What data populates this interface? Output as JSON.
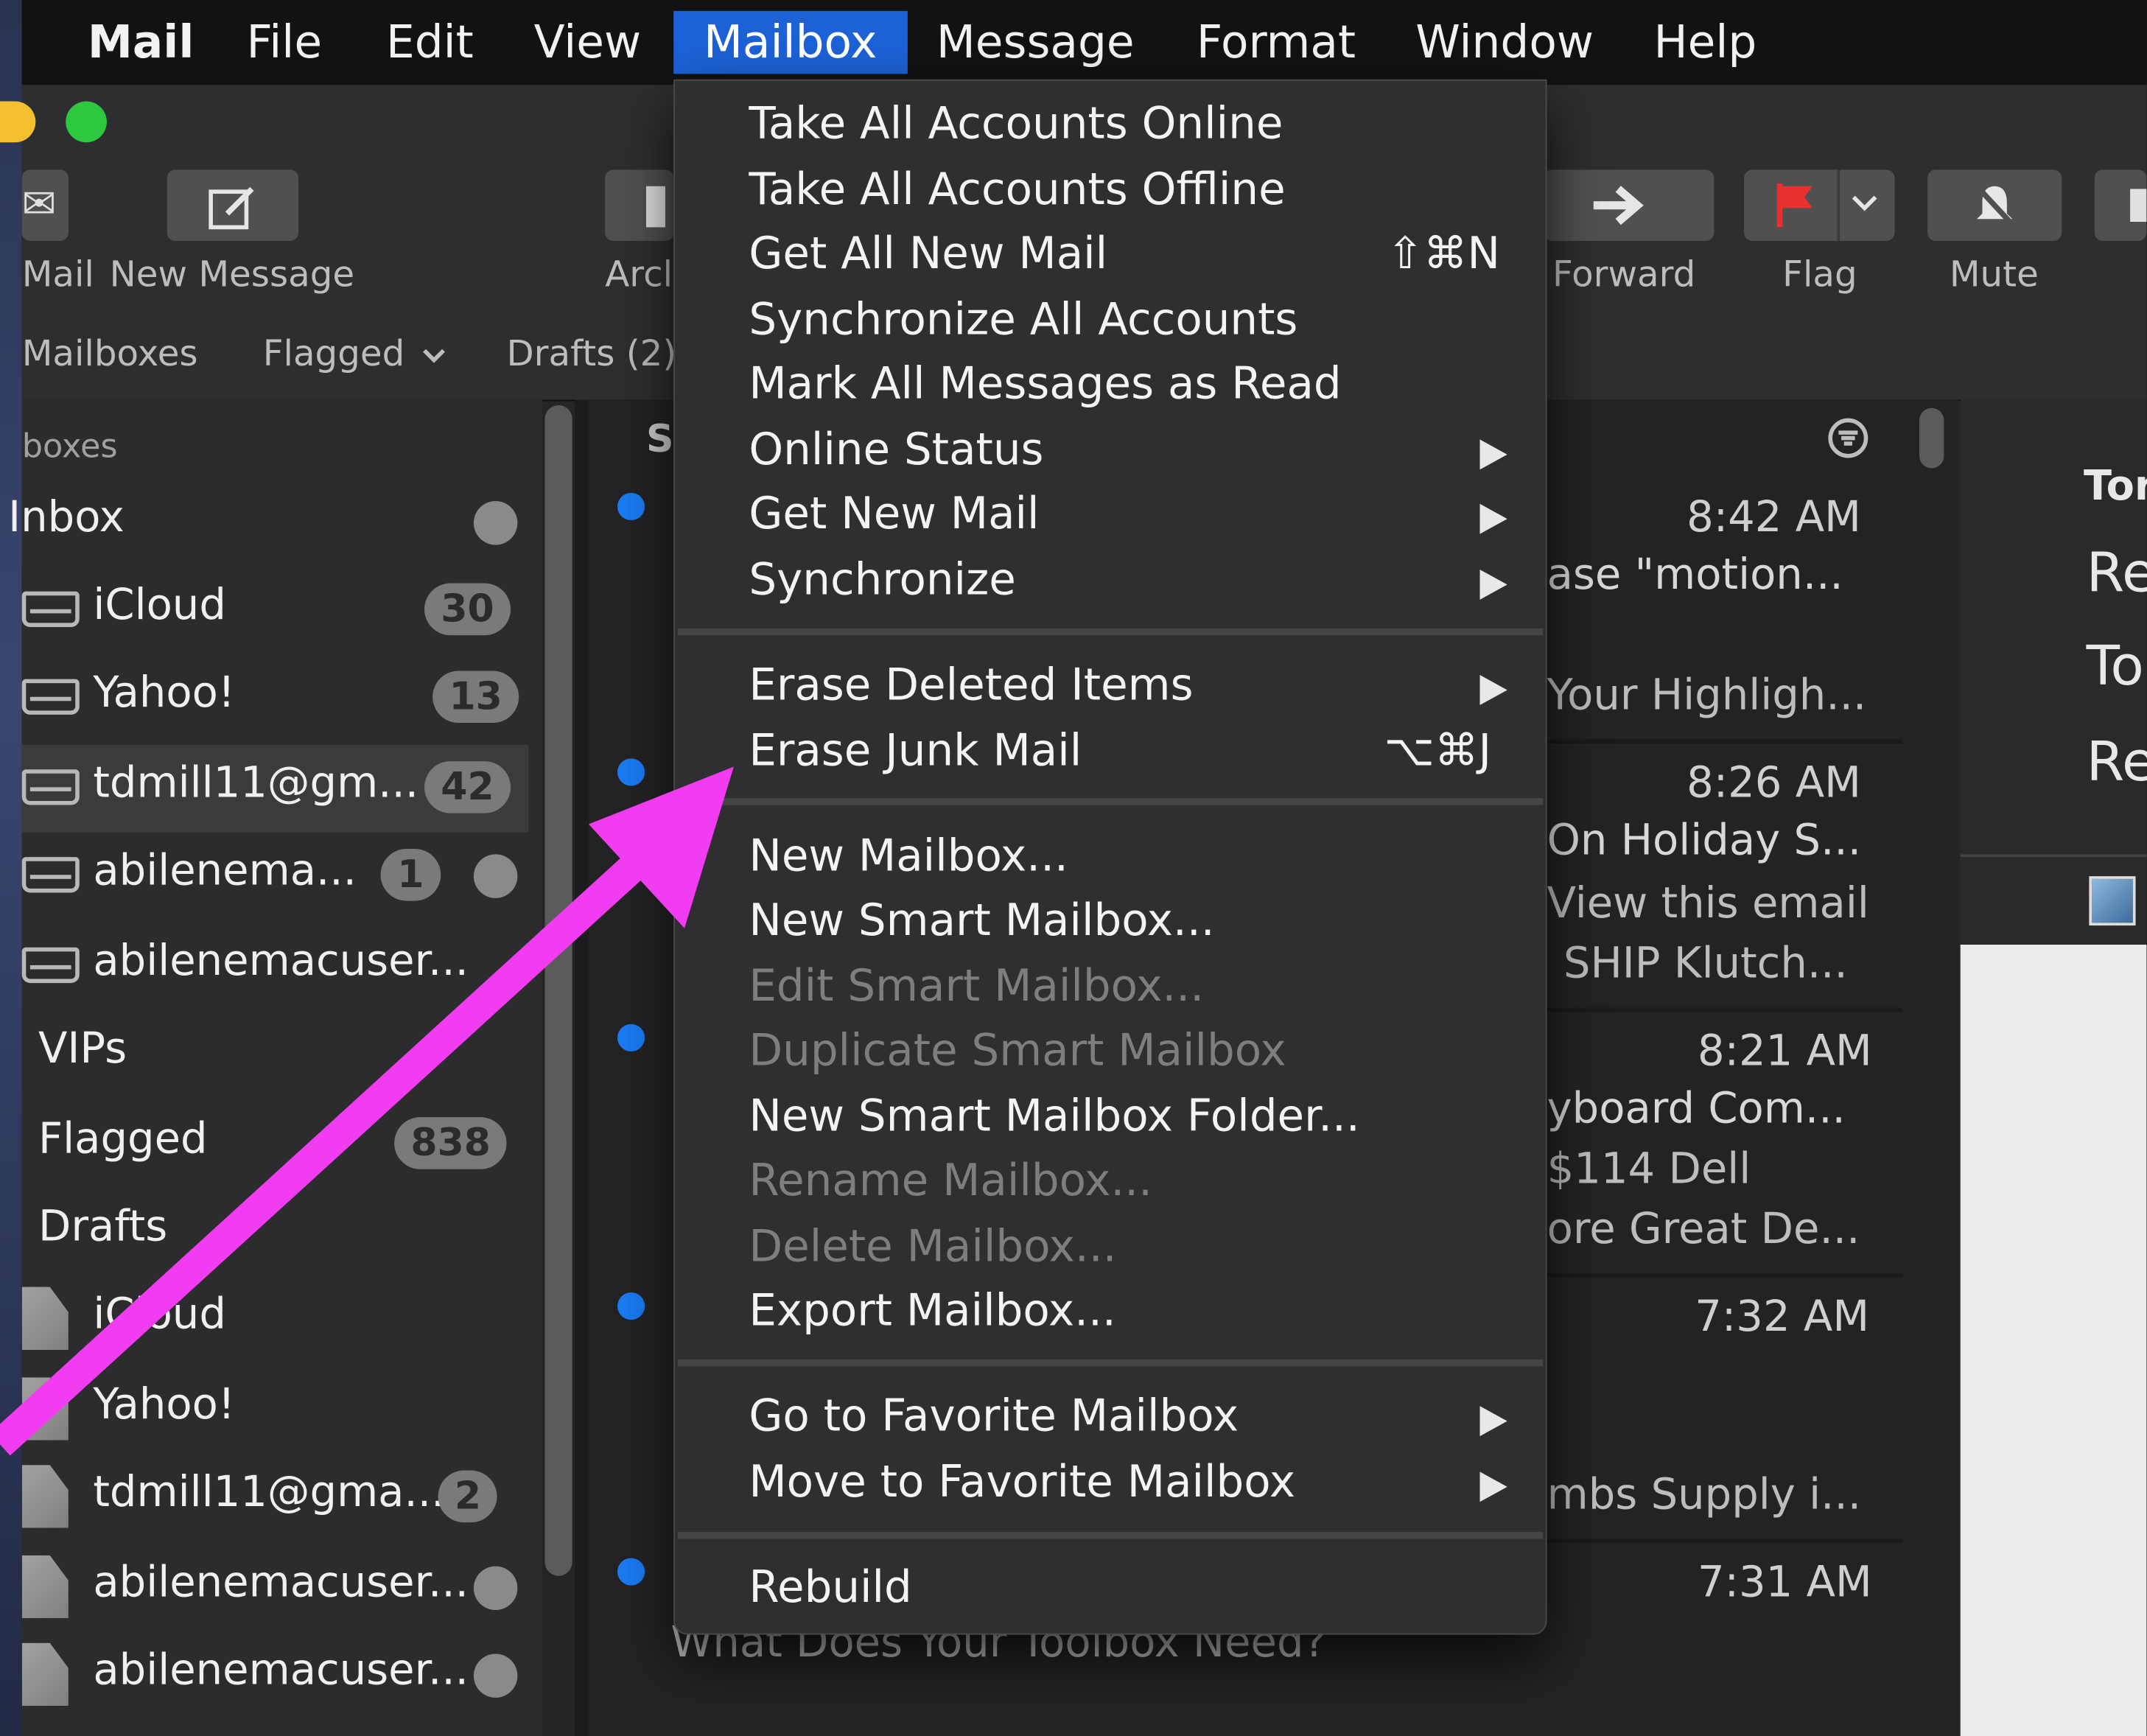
{
  "menubar": {
    "app": "Mail",
    "items": [
      "File",
      "Edit",
      "View",
      "Mailbox",
      "Message",
      "Format",
      "Window",
      "Help"
    ],
    "active": "Mailbox"
  },
  "toolbar": {
    "get_mail_label": "Mail",
    "new_message_label": "New Message",
    "archive_label": "Arcl",
    "forward_label": "Forward",
    "flag_label": "Flag",
    "mute_label": "Mute"
  },
  "favorites_bar": {
    "mailboxes": "Mailboxes",
    "flagged": "Flagged",
    "drafts": "Drafts (2)"
  },
  "sidebar": {
    "section_header": "boxes",
    "items": [
      {
        "label": "Inbox"
      },
      {
        "label": "iCloud",
        "badge": "30"
      },
      {
        "label": "Yahoo!",
        "badge": "13"
      },
      {
        "label": "tdmill11@gm...",
        "badge": "42"
      },
      {
        "label": "abilenema...",
        "badge": "1"
      },
      {
        "label": "abilenemacuser..."
      },
      {
        "label": "VIPs"
      },
      {
        "label": "Flagged",
        "badge": "838"
      },
      {
        "label": "Drafts"
      },
      {
        "label": "iCloud"
      },
      {
        "label": "Yahoo!"
      },
      {
        "label": "tdmill11@gma...",
        "badge": "2"
      },
      {
        "label": "abilenemacuser..."
      },
      {
        "label": "abilenemacuser..."
      }
    ]
  },
  "message_list": {
    "sort_header": "S",
    "messages": [
      {
        "time": "8:42 AM",
        "line1": "ase \"motion...",
        "line2": "Your Highligh..."
      },
      {
        "time": "8:26 AM",
        "line1": "On Holiday S...",
        "line2": "View this email",
        "line3": "SHIP Klutch..."
      },
      {
        "time": "8:21 AM",
        "line1": "yboard Com...",
        "line2": "$114 Dell",
        "line3": "ore Great De..."
      },
      {
        "time": "7:32 AM",
        "line1": "",
        "line2": "mbs Supply i..."
      },
      {
        "time": "7:31 AM",
        "line1": "What Does Your Toolbox Need?"
      }
    ]
  },
  "reading_pane": {
    "lines": [
      "Tor",
      "Re",
      "To",
      "Re"
    ]
  },
  "mailbox_menu": {
    "groups": [
      [
        {
          "label": "Take All Accounts Online"
        },
        {
          "label": "Take All Accounts Offline"
        },
        {
          "label": "Get All New Mail",
          "shortcut": "⇧⌘N"
        },
        {
          "label": "Synchronize All Accounts"
        },
        {
          "label": "Mark All Messages as Read"
        },
        {
          "label": "Online Status",
          "submenu": true
        },
        {
          "label": "Get New Mail",
          "submenu": true
        },
        {
          "label": "Synchronize",
          "submenu": true
        }
      ],
      [
        {
          "label": "Erase Deleted Items",
          "submenu": true
        },
        {
          "label": "Erase Junk Mail",
          "shortcut": "⌥⌘J"
        }
      ],
      [
        {
          "label": "New Mailbox..."
        },
        {
          "label": "New Smart Mailbox..."
        },
        {
          "label": "Edit Smart Mailbox...",
          "disabled": true
        },
        {
          "label": "Duplicate Smart Mailbox",
          "disabled": true
        },
        {
          "label": "New Smart Mailbox Folder..."
        },
        {
          "label": "Rename Mailbox...",
          "disabled": true
        },
        {
          "label": "Delete Mailbox...",
          "disabled": true
        },
        {
          "label": "Export Mailbox..."
        }
      ],
      [
        {
          "label": "Go to Favorite Mailbox",
          "submenu": true
        },
        {
          "label": "Move to Favorite Mailbox",
          "submenu": true
        }
      ],
      [
        {
          "label": "Rebuild"
        }
      ]
    ]
  },
  "colors": {
    "menu_highlight": "#1c61d6",
    "annotation_arrow": "#f23cf2",
    "unread_dot": "#1a7bf2",
    "flag_red": "#e8312f"
  }
}
